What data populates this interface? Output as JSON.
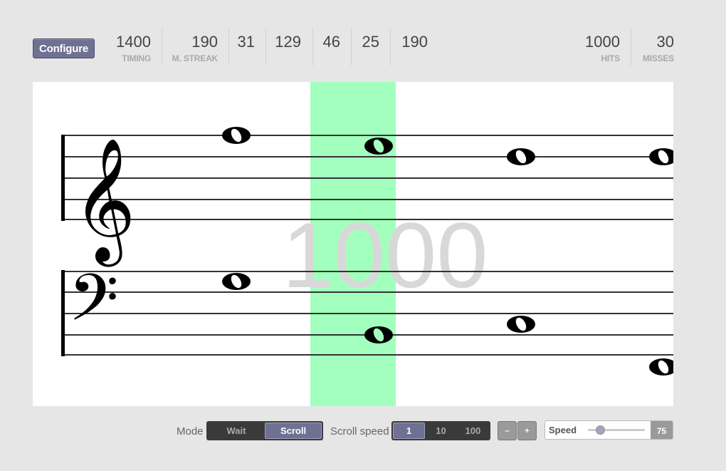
{
  "toolbar": {
    "configure_label": "Configure"
  },
  "stats": [
    {
      "value": "1400",
      "label": "TIMING"
    },
    {
      "value": "190",
      "label": "M. STREAK"
    },
    {
      "value": "31",
      "label": ""
    },
    {
      "value": "129",
      "label": ""
    },
    {
      "value": "46",
      "label": ""
    },
    {
      "value": "25",
      "label": ""
    },
    {
      "value": "190",
      "label": ""
    }
  ],
  "results": {
    "hits_value": "1000",
    "hits_label": "HITS",
    "misses_value": "30",
    "misses_label": "MISSES"
  },
  "staff": {
    "score_overlay": "1000",
    "highlight_color": "#a3ffbd",
    "treble_notes": [
      "note-1",
      "note-2",
      "note-3",
      "note-4"
    ],
    "bass_notes": [
      "note-1",
      "note-2",
      "note-3",
      "note-4"
    ]
  },
  "controls": {
    "mode_label": "Mode",
    "mode_options": [
      "Wait",
      "Scroll"
    ],
    "mode_selected": "Scroll",
    "scroll_speed_label": "Scroll speed",
    "scroll_speed_options": [
      "1",
      "10",
      "100"
    ],
    "scroll_speed_selected": "1",
    "zoom_out_label": "–",
    "zoom_in_label": "+",
    "speed_label": "Speed",
    "speed_value": "75"
  },
  "colors": {
    "accent": "#6e7192",
    "background": "#e6e6e6",
    "highlight": "#a3ffbd"
  }
}
